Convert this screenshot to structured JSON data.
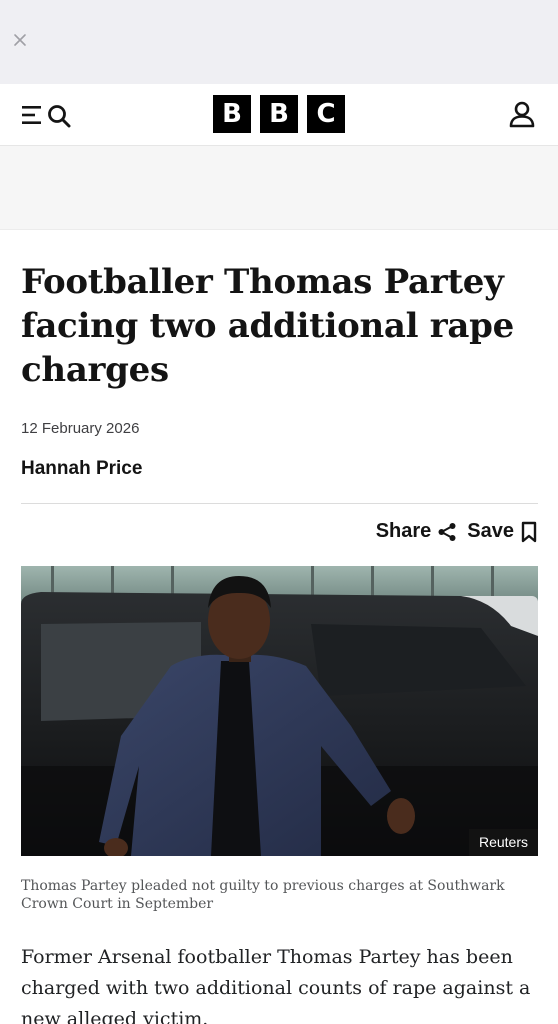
{
  "top_bar": {
    "close_icon": "close-icon"
  },
  "masthead": {
    "menu_icon": "menu-icon",
    "search_icon": "search-icon",
    "logo_letters": [
      "B",
      "B",
      "C"
    ],
    "account_icon": "person-icon",
    "logo_color": "#000000"
  },
  "article": {
    "headline": "Footballer Thomas Partey facing two additional rape charges",
    "date": "12 February 2026",
    "author": "Hannah Price",
    "share_label": "Share",
    "save_label": "Save",
    "image": {
      "credit": "Reuters",
      "caption": "Thomas Partey pleaded not guilty to previous charges at Southwark Crown Court in September"
    },
    "body_intro": "Former Arsenal footballer Thomas Partey has been charged with two additional counts of rape against a new alleged victim."
  }
}
